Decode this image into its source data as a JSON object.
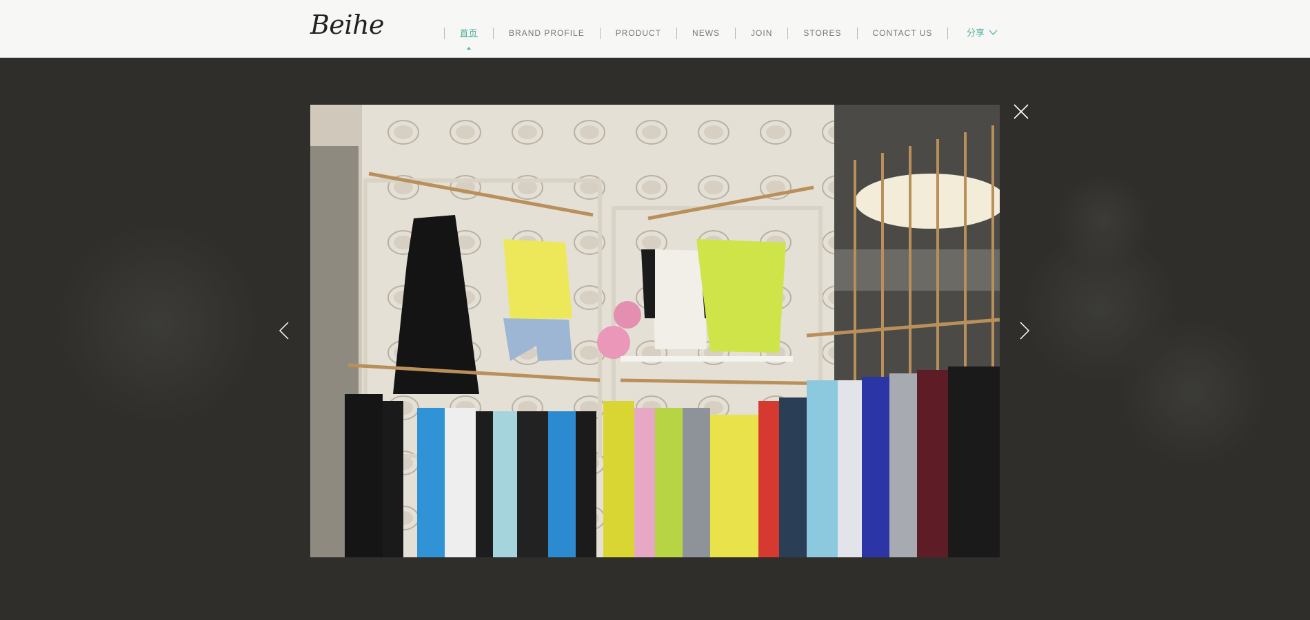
{
  "header": {
    "logo_text": "Beihe",
    "nav": [
      {
        "label": "首页",
        "active": true
      },
      {
        "label": "BRAND PROFILE",
        "active": false
      },
      {
        "label": "PRODUCT",
        "active": false
      },
      {
        "label": "NEWS",
        "active": false
      },
      {
        "label": "JOIN",
        "active": false
      },
      {
        "label": "STORES",
        "active": false
      },
      {
        "label": "CONTACT US",
        "active": false
      }
    ],
    "share_label": "分享",
    "share_icon": "chevron-down-icon"
  },
  "lightbox": {
    "image_alt": "Beihe store interior with clothing racks",
    "close_icon": "close-icon",
    "prev_icon": "chevron-left-icon",
    "next_icon": "chevron-right-icon"
  },
  "colors": {
    "accent": "#4aaea0",
    "overlay": "#2f2e2b",
    "header_bg": "#f7f7f5",
    "nav_text": "#777777"
  }
}
